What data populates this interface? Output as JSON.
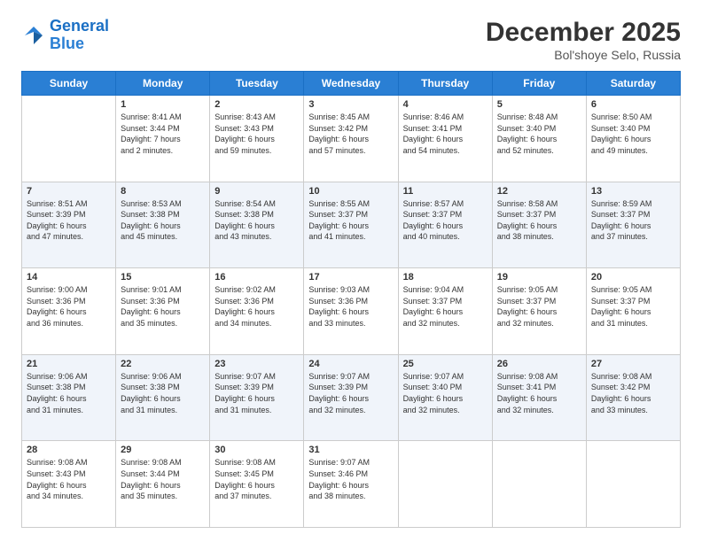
{
  "header": {
    "logo_general": "General",
    "logo_blue": "Blue",
    "month_year": "December 2025",
    "location": "Bol'shoye Selo, Russia"
  },
  "days_of_week": [
    "Sunday",
    "Monday",
    "Tuesday",
    "Wednesday",
    "Thursday",
    "Friday",
    "Saturday"
  ],
  "weeks": [
    [
      {
        "day": "",
        "info": ""
      },
      {
        "day": "1",
        "info": "Sunrise: 8:41 AM\nSunset: 3:44 PM\nDaylight: 7 hours\nand 2 minutes."
      },
      {
        "day": "2",
        "info": "Sunrise: 8:43 AM\nSunset: 3:43 PM\nDaylight: 6 hours\nand 59 minutes."
      },
      {
        "day": "3",
        "info": "Sunrise: 8:45 AM\nSunset: 3:42 PM\nDaylight: 6 hours\nand 57 minutes."
      },
      {
        "day": "4",
        "info": "Sunrise: 8:46 AM\nSunset: 3:41 PM\nDaylight: 6 hours\nand 54 minutes."
      },
      {
        "day": "5",
        "info": "Sunrise: 8:48 AM\nSunset: 3:40 PM\nDaylight: 6 hours\nand 52 minutes."
      },
      {
        "day": "6",
        "info": "Sunrise: 8:50 AM\nSunset: 3:40 PM\nDaylight: 6 hours\nand 49 minutes."
      }
    ],
    [
      {
        "day": "7",
        "info": "Sunrise: 8:51 AM\nSunset: 3:39 PM\nDaylight: 6 hours\nand 47 minutes."
      },
      {
        "day": "8",
        "info": "Sunrise: 8:53 AM\nSunset: 3:38 PM\nDaylight: 6 hours\nand 45 minutes."
      },
      {
        "day": "9",
        "info": "Sunrise: 8:54 AM\nSunset: 3:38 PM\nDaylight: 6 hours\nand 43 minutes."
      },
      {
        "day": "10",
        "info": "Sunrise: 8:55 AM\nSunset: 3:37 PM\nDaylight: 6 hours\nand 41 minutes."
      },
      {
        "day": "11",
        "info": "Sunrise: 8:57 AM\nSunset: 3:37 PM\nDaylight: 6 hours\nand 40 minutes."
      },
      {
        "day": "12",
        "info": "Sunrise: 8:58 AM\nSunset: 3:37 PM\nDaylight: 6 hours\nand 38 minutes."
      },
      {
        "day": "13",
        "info": "Sunrise: 8:59 AM\nSunset: 3:37 PM\nDaylight: 6 hours\nand 37 minutes."
      }
    ],
    [
      {
        "day": "14",
        "info": "Sunrise: 9:00 AM\nSunset: 3:36 PM\nDaylight: 6 hours\nand 36 minutes."
      },
      {
        "day": "15",
        "info": "Sunrise: 9:01 AM\nSunset: 3:36 PM\nDaylight: 6 hours\nand 35 minutes."
      },
      {
        "day": "16",
        "info": "Sunrise: 9:02 AM\nSunset: 3:36 PM\nDaylight: 6 hours\nand 34 minutes."
      },
      {
        "day": "17",
        "info": "Sunrise: 9:03 AM\nSunset: 3:36 PM\nDaylight: 6 hours\nand 33 minutes."
      },
      {
        "day": "18",
        "info": "Sunrise: 9:04 AM\nSunset: 3:37 PM\nDaylight: 6 hours\nand 32 minutes."
      },
      {
        "day": "19",
        "info": "Sunrise: 9:05 AM\nSunset: 3:37 PM\nDaylight: 6 hours\nand 32 minutes."
      },
      {
        "day": "20",
        "info": "Sunrise: 9:05 AM\nSunset: 3:37 PM\nDaylight: 6 hours\nand 31 minutes."
      }
    ],
    [
      {
        "day": "21",
        "info": "Sunrise: 9:06 AM\nSunset: 3:38 PM\nDaylight: 6 hours\nand 31 minutes."
      },
      {
        "day": "22",
        "info": "Sunrise: 9:06 AM\nSunset: 3:38 PM\nDaylight: 6 hours\nand 31 minutes."
      },
      {
        "day": "23",
        "info": "Sunrise: 9:07 AM\nSunset: 3:39 PM\nDaylight: 6 hours\nand 31 minutes."
      },
      {
        "day": "24",
        "info": "Sunrise: 9:07 AM\nSunset: 3:39 PM\nDaylight: 6 hours\nand 32 minutes."
      },
      {
        "day": "25",
        "info": "Sunrise: 9:07 AM\nSunset: 3:40 PM\nDaylight: 6 hours\nand 32 minutes."
      },
      {
        "day": "26",
        "info": "Sunrise: 9:08 AM\nSunset: 3:41 PM\nDaylight: 6 hours\nand 32 minutes."
      },
      {
        "day": "27",
        "info": "Sunrise: 9:08 AM\nSunset: 3:42 PM\nDaylight: 6 hours\nand 33 minutes."
      }
    ],
    [
      {
        "day": "28",
        "info": "Sunrise: 9:08 AM\nSunset: 3:43 PM\nDaylight: 6 hours\nand 34 minutes."
      },
      {
        "day": "29",
        "info": "Sunrise: 9:08 AM\nSunset: 3:44 PM\nDaylight: 6 hours\nand 35 minutes."
      },
      {
        "day": "30",
        "info": "Sunrise: 9:08 AM\nSunset: 3:45 PM\nDaylight: 6 hours\nand 37 minutes."
      },
      {
        "day": "31",
        "info": "Sunrise: 9:07 AM\nSunset: 3:46 PM\nDaylight: 6 hours\nand 38 minutes."
      },
      {
        "day": "",
        "info": ""
      },
      {
        "day": "",
        "info": ""
      },
      {
        "day": "",
        "info": ""
      }
    ]
  ]
}
